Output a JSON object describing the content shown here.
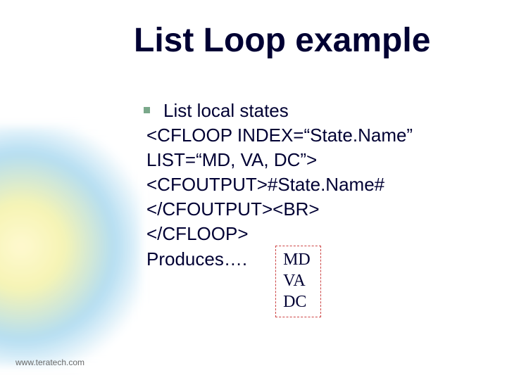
{
  "title": "List Loop example",
  "bullet_text": "List local states",
  "code": {
    "l1": "<CFLOOP INDEX=“State.Name”",
    "l2": "LIST=“MD, VA, DC”>",
    "l3": "<CFOUTPUT>#State.Name#",
    "l4": "</CFOUTPUT><BR>",
    "l5": "</CFLOOP>",
    "produces": "Produces…."
  },
  "output": {
    "r1": "MD",
    "r2": "VA",
    "r3": "DC"
  },
  "footer": "www.teratech.com"
}
